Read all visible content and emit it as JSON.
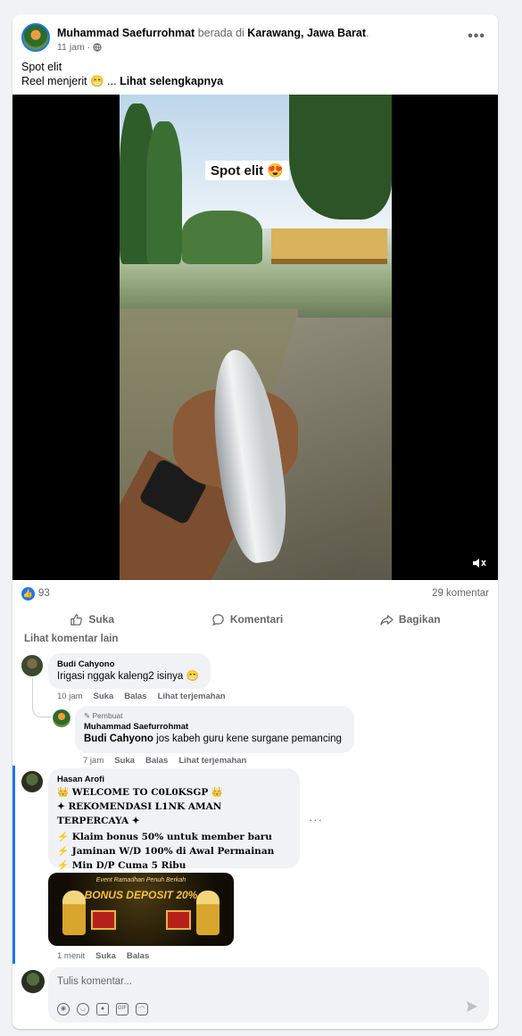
{
  "post": {
    "author": "Muhammad Saefurrohmat",
    "location_prefix": "berada di",
    "location": "Karawang, Jawa Barat",
    "location_suffix": ".",
    "time": "11 jam",
    "visibility_sep": "·",
    "caption_line1": "Spot elit",
    "caption_line2": "Reel menjerit 😁 ...",
    "see_more": "Lihat selengkapnya",
    "video_overlay_text": "Spot elit 😍",
    "like_count": "93",
    "comment_count": "29 komentar",
    "actions": {
      "like": "Suka",
      "comment": "Komentari",
      "share": "Bagikan"
    }
  },
  "comments_section": {
    "view_more": "Lihat komentar lain",
    "comments": [
      {
        "name": "Budi Cahyono",
        "text": "Irigasi nggak kaleng2 isinya 😁",
        "time": "10 jam",
        "like": "Suka",
        "reply": "Balas",
        "translate": "Lihat terjemahan"
      },
      {
        "author_tag": "Pembuat",
        "name": "Muhammad Saefurrohmat",
        "mention": "Budi Cahyono",
        "text": " jos kabeh guru kene surgane pemancing",
        "time": "7 jam",
        "like": "Suka",
        "reply": "Balas",
        "translate": "Lihat terjemahan"
      },
      {
        "name": "Hasan Arofi",
        "lines": [
          "👑 WELCOME TO C0L0KSGP 👑",
          "✦ REKOMENDASI L1NK AMAN TERPERCAYA ✦",
          "⚡ Klaim bonus 50% untuk member baru",
          "⚡ Jaminan W/D 100% di Awal Permainan",
          "⚡ Min D/P Cuma 5 Ribu"
        ],
        "banner_sub": "Event Ramadhan Penuh Berkah",
        "banner_title": "BONUS DEPOSIT 20%",
        "time": "1 menit",
        "like": "Suka",
        "reply": "Balas"
      }
    ]
  },
  "composer": {
    "placeholder": "Tulis komentar..."
  },
  "colors": {
    "accent": "#1877f2",
    "background": "#f0f2f5",
    "muted_text": "#65676b"
  }
}
